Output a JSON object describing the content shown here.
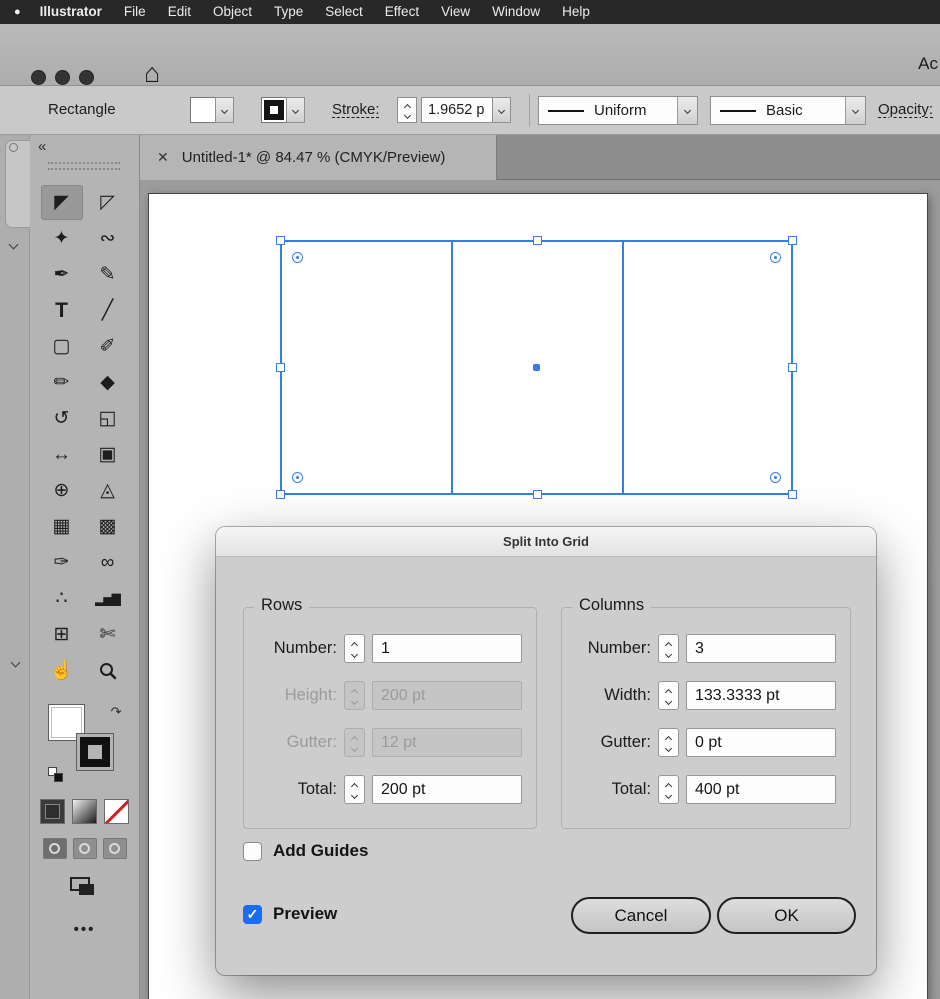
{
  "menu_bar": {
    "apple_icon": "●",
    "items": [
      "Illustrator",
      "File",
      "Edit",
      "Object",
      "Type",
      "Select",
      "Effect",
      "View",
      "Window",
      "Help"
    ]
  },
  "header": {
    "home_icon": "⌂",
    "right_text": "Ac"
  },
  "options_bar": {
    "tool_name": "Rectangle",
    "stroke_label": "Stroke:",
    "stroke_weight": "1.9652 p",
    "width_profile": "Uniform",
    "brush": "Basic",
    "opacity_label": "Opacity:"
  },
  "document_tab": {
    "close_glyph": "✕",
    "title": "Untitled-1* @ 84.47 % (CMYK/Preview)"
  },
  "toolbar": {
    "collapse_glyph": "«",
    "more_glyph": "•••",
    "tools": [
      {
        "name": "selection-tool",
        "glyph": "◤"
      },
      {
        "name": "direct-selection-tool",
        "glyph": "◸"
      },
      {
        "name": "magic-wand-tool",
        "glyph": "✦"
      },
      {
        "name": "lasso-tool",
        "glyph": "∾"
      },
      {
        "name": "pen-tool",
        "glyph": "✒"
      },
      {
        "name": "curvature-tool",
        "glyph": "✎"
      },
      {
        "name": "type-tool",
        "glyph": "T"
      },
      {
        "name": "line-segment-tool",
        "glyph": "╱"
      },
      {
        "name": "rectangle-tool",
        "glyph": "▢"
      },
      {
        "name": "paintbrush-tool",
        "glyph": "✐"
      },
      {
        "name": "shaper-tool",
        "glyph": "✏"
      },
      {
        "name": "eraser-tool",
        "glyph": "◆"
      },
      {
        "name": "rotate-tool",
        "glyph": "↺"
      },
      {
        "name": "scale-tool",
        "glyph": "◱"
      },
      {
        "name": "width-tool",
        "glyph": "↔"
      },
      {
        "name": "free-transform-tool",
        "glyph": "▣"
      },
      {
        "name": "shape-builder-tool",
        "glyph": "⊕"
      },
      {
        "name": "perspective-grid-tool",
        "glyph": "◬"
      },
      {
        "name": "mesh-tool",
        "glyph": "▦"
      },
      {
        "name": "gradient-tool",
        "glyph": "▩"
      },
      {
        "name": "eyedropper-tool",
        "glyph": "✑"
      },
      {
        "name": "blend-tool",
        "glyph": "∞"
      },
      {
        "name": "symbol-sprayer-tool",
        "glyph": "∴"
      },
      {
        "name": "column-graph-tool",
        "glyph": "▂▅▇"
      },
      {
        "name": "artboard-tool",
        "glyph": "⊞"
      },
      {
        "name": "slice-tool",
        "glyph": "✄"
      },
      {
        "name": "hand-tool",
        "glyph": "☝"
      },
      {
        "name": "zoom-tool",
        "glyph": ""
      }
    ]
  },
  "dialog": {
    "title": "Split Into Grid",
    "rows": {
      "legend": "Rows",
      "fields": [
        {
          "label": "Number:",
          "value": "1",
          "enabled": true
        },
        {
          "label": "Height:",
          "value": "200 pt",
          "enabled": false
        },
        {
          "label": "Gutter:",
          "value": "12 pt",
          "enabled": false
        },
        {
          "label": "Total:",
          "value": "200 pt",
          "enabled": true
        }
      ]
    },
    "columns": {
      "legend": "Columns",
      "fields": [
        {
          "label": "Number:",
          "value": "3",
          "enabled": true
        },
        {
          "label": "Width:",
          "value": "133.3333 pt",
          "enabled": true
        },
        {
          "label": "Gutter:",
          "value": "0 pt",
          "enabled": true
        },
        {
          "label": "Total:",
          "value": "400 pt",
          "enabled": true
        }
      ]
    },
    "add_guides": {
      "label": "Add Guides",
      "checked": false
    },
    "preview": {
      "label": "Preview",
      "checked": true
    },
    "cancel_label": "Cancel",
    "ok_label": "OK"
  },
  "colors": {
    "selection_blue": "#3a7de2",
    "checkbox_blue": "#1a6df2",
    "none_slash_red": "#d21f1f"
  }
}
